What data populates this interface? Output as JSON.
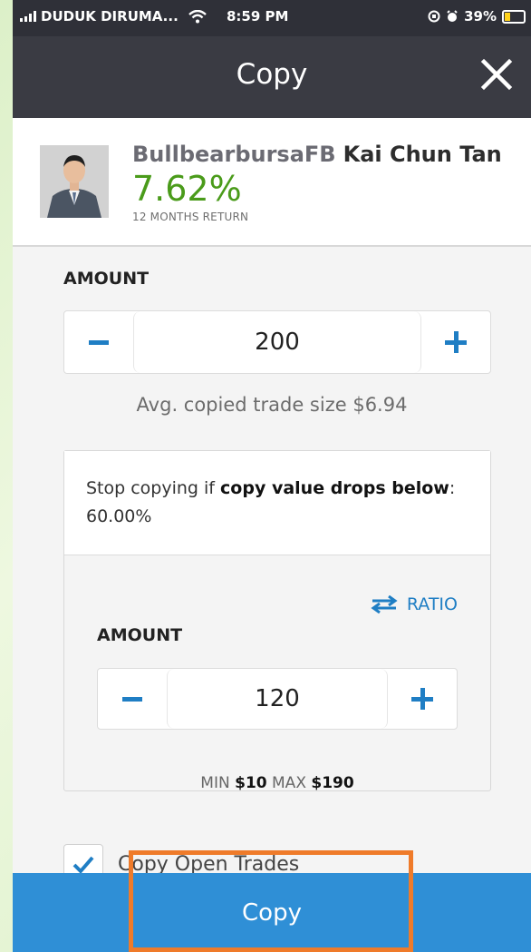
{
  "status_bar": {
    "carrier": "DUDUK DIRUMA...",
    "time": "8:59 PM",
    "battery": "39%",
    "icons": [
      "signal-icon",
      "wifi-icon",
      "screen-lock-icon",
      "alarm-icon",
      "battery-icon"
    ]
  },
  "nav": {
    "title": "Copy",
    "close_icon": "close-icon"
  },
  "trader": {
    "username": "BullbearbursaFB",
    "full_name": "Kai Chun Tan",
    "return_value": "7.62%",
    "return_label": "12 MONTHS RETURN"
  },
  "amount": {
    "label": "AMOUNT",
    "value": "200",
    "avg_text": "Avg. copied trade size $6.94"
  },
  "stop_loss": {
    "text_prefix": "Stop copying if ",
    "text_bold": "copy value drops below",
    "text_suffix": ": 60.00%",
    "ratio_label": "RATIO",
    "amount_label": "AMOUNT",
    "amount_value": "120",
    "min_label": "MIN",
    "min_value": "$10",
    "max_label": "MAX",
    "max_value": "$190"
  },
  "copy_open_trades": {
    "label": "Copy Open Trades",
    "checked": true
  },
  "copy_button": {
    "label": "Copy"
  },
  "colors": {
    "accent_blue": "#1f7ec4",
    "button_blue": "#2f8fd6",
    "return_green": "#4a9b1a",
    "highlight_orange": "#ef7b2a"
  }
}
